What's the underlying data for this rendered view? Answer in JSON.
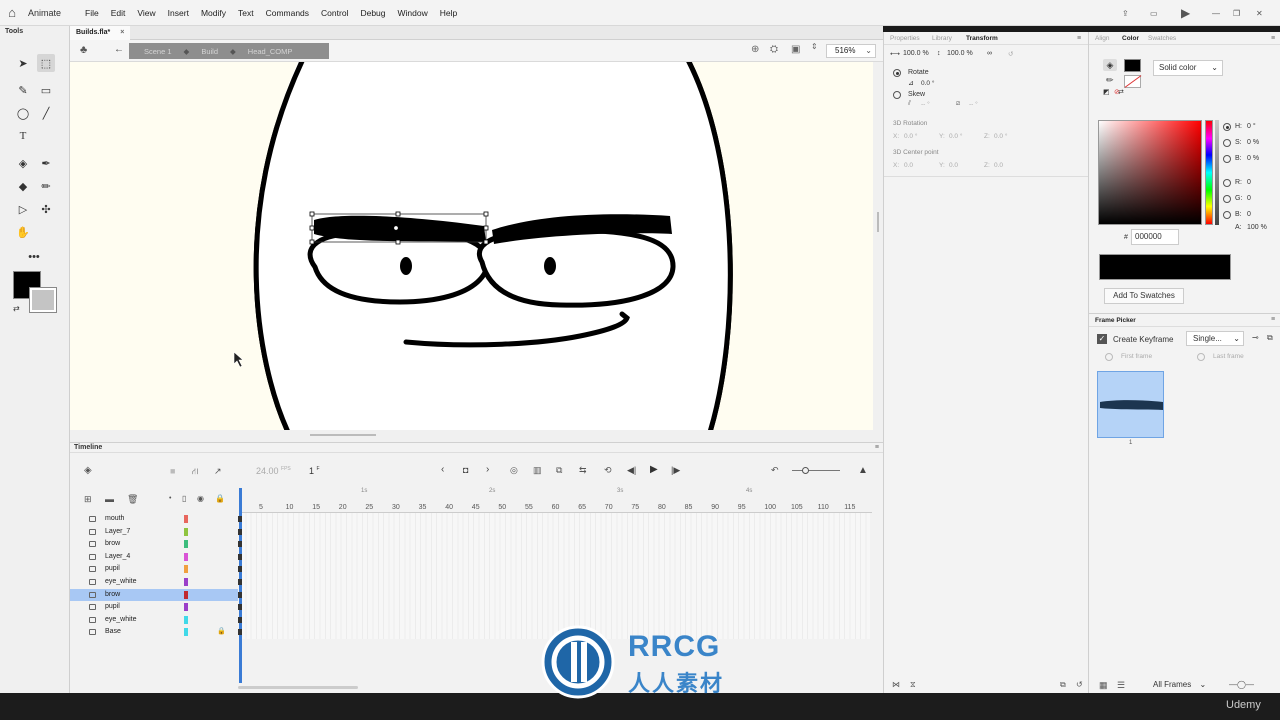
{
  "app": {
    "name": "Animate"
  },
  "menu": [
    "File",
    "Edit",
    "View",
    "Insert",
    "Modify",
    "Text",
    "Commands",
    "Control",
    "Debug",
    "Window",
    "Help"
  ],
  "tools_panel": {
    "title": "Tools"
  },
  "document": {
    "tab": "Builds.fla*",
    "close": "×"
  },
  "breadcrumb": {
    "scene": "Scene 1",
    "symbol1": "Build",
    "symbol2": "Head_COMP"
  },
  "zoom": "516%",
  "timeline": {
    "title": "Timeline",
    "fps": "24.00",
    "fps_unit": "FPS",
    "current_frame": "1",
    "frame_unit": "F",
    "seconds": [
      "1s",
      "2s",
      "3s",
      "4s"
    ],
    "frame_numbers": [
      "5",
      "10",
      "15",
      "20",
      "25",
      "30",
      "35",
      "40",
      "45",
      "50",
      "55",
      "60",
      "65",
      "70",
      "75",
      "80",
      "85",
      "90",
      "95",
      "100",
      "105",
      "110",
      "115"
    ],
    "layers": [
      {
        "name": "mouth",
        "color": "#e8675e",
        "selected": false,
        "locked": false
      },
      {
        "name": "Layer_7",
        "color": "#8fc43f",
        "selected": false,
        "locked": false
      },
      {
        "name": "brow",
        "color": "#3dbd7d",
        "selected": false,
        "locked": false
      },
      {
        "name": "Layer_4",
        "color": "#d954d6",
        "selected": false,
        "locked": false
      },
      {
        "name": "pupil",
        "color": "#f0a040",
        "selected": false,
        "locked": false
      },
      {
        "name": "eye_white",
        "color": "#9b3fc9",
        "selected": false,
        "locked": false
      },
      {
        "name": "brow",
        "color": "#c0292e",
        "selected": true,
        "locked": false
      },
      {
        "name": "pupil",
        "color": "#9b3fc9",
        "selected": false,
        "locked": false
      },
      {
        "name": "eye_white",
        "color": "#41d9e8",
        "selected": false,
        "locked": false
      },
      {
        "name": "Base",
        "color": "#41d9e8",
        "selected": false,
        "locked": true
      }
    ]
  },
  "properties": {
    "tabs": [
      "Properties",
      "Library",
      "Transform"
    ],
    "active_tab": "Transform",
    "scale_w": "100.0 %",
    "scale_h": "100.0 %",
    "rotate_label": "Rotate",
    "rotate_value": "0.0 °",
    "skew_label": "Skew",
    "skew_h": "-- °",
    "skew_v": "-- °",
    "rotation3d_label": "3D Rotation",
    "rot3d": {
      "x": "0.0 °",
      "y": "0.0 °",
      "z": "0.0 °"
    },
    "center3d_label": "3D Center point",
    "center3d": {
      "x": "0.0",
      "y": "0.0",
      "z": "0.0"
    }
  },
  "color_panel": {
    "tabs": [
      "Align",
      "Color",
      "Swatches"
    ],
    "active_tab": "Color",
    "fill_type": "Solid color",
    "H": "0 °",
    "S": "0 %",
    "B": "0 %",
    "R": "0",
    "G": "0",
    "Bl": "0",
    "A": "100 %",
    "hex": "000000",
    "add_swatch": "Add To Swatches",
    "current_color": "#000000"
  },
  "frame_picker": {
    "title": "Frame Picker",
    "create_keyframe": "Create Keyframe",
    "mode": "Single...",
    "first_frame": "First frame",
    "last_frame": "Last frame",
    "thumb_label": "1",
    "filter": "All Frames"
  },
  "watermark": {
    "big": "RRCG",
    "small": "人人素材"
  },
  "brand": "Udemy"
}
